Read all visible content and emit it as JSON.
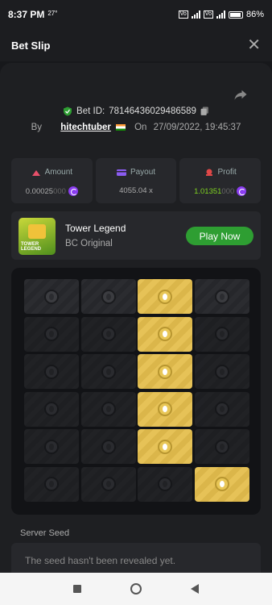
{
  "status": {
    "time": "8:37 PM",
    "temp": "27°",
    "volte": "Vo LTE",
    "battery": "86%"
  },
  "header": {
    "title": "Bet Slip",
    "close": "✕"
  },
  "bet": {
    "id_label": "Bet ID:",
    "id": "78146436029486589",
    "by_label": "By",
    "user": "hitechtuber",
    "on_label": "On",
    "datetime": "27/09/2022, 19:45:37"
  },
  "stats": {
    "amount_label": "Amount",
    "amount_value": "0.00025",
    "amount_dim": "000",
    "payout_label": "Payout",
    "payout_value": "4055.04 x",
    "profit_label": "Profit",
    "profit_value": "1.01351",
    "profit_dim": "000"
  },
  "game": {
    "thumb_text": "TOWER LEGEND",
    "name": "Tower Legend",
    "subtitle": "BC Original",
    "play_label": "Play Now"
  },
  "board": {
    "rows": 6,
    "cols": 4,
    "gold": [
      [
        0,
        2
      ],
      [
        1,
        2
      ],
      [
        2,
        2
      ],
      [
        3,
        2
      ],
      [
        4,
        2
      ],
      [
        5,
        3
      ]
    ]
  },
  "seed": {
    "label": "Server Seed",
    "text": "The seed hasn't been revealed yet."
  },
  "colors": {
    "accent_green": "#2e9e32",
    "gold": "#e6c257",
    "profit_green": "#7fd321",
    "coin_purple": "#8a3cf0"
  },
  "icons": [
    "shield-check-icon",
    "copy-icon",
    "share-icon",
    "amount-icon",
    "payout-icon",
    "profit-icon",
    "coin-icon"
  ]
}
